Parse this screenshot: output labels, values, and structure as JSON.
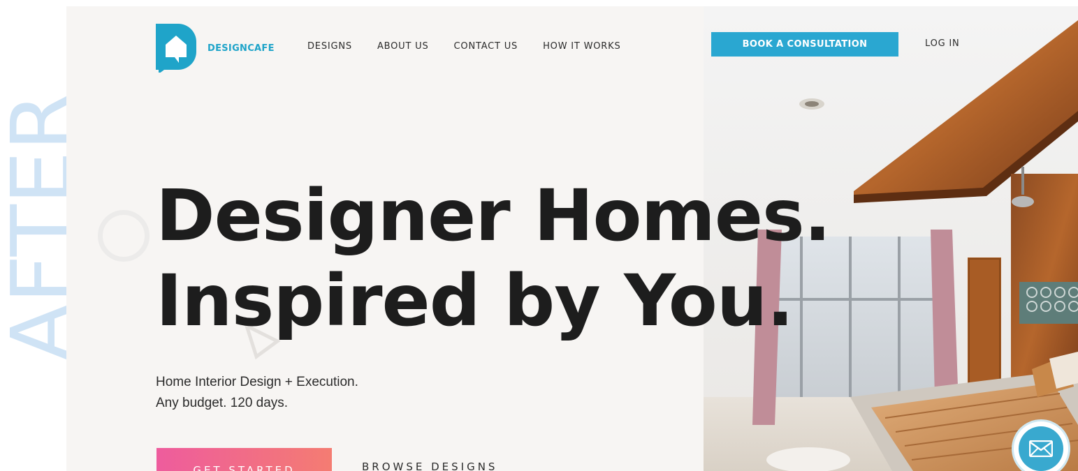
{
  "overlay": {
    "label": "AFTER"
  },
  "brand": {
    "name": "DESIGNCAFE",
    "accent_color": "#1fa4c9"
  },
  "nav": {
    "items": [
      {
        "label": "DESIGNS"
      },
      {
        "label": "ABOUT US"
      },
      {
        "label": "CONTACT US"
      },
      {
        "label": "HOW IT WORKS"
      }
    ],
    "cta_label": "BOOK A CONSULTATION",
    "login_label": "LOG IN"
  },
  "hero": {
    "headline_line1": "Designer Homes.",
    "headline_line2": "Inspired by You.",
    "sub_line1": "Home Interior Design + Execution.",
    "sub_line2": "Any budget. 120 days.",
    "primary_button": "GET STARTED",
    "secondary_button": "BROWSE DESIGNS",
    "image_subject": "bedroom-interior-photo"
  },
  "chat": {
    "icon": "envelope-icon"
  },
  "colors": {
    "cta_blue": "#2aa7d1",
    "gradient_start": "#ee5c9d",
    "gradient_end": "#f47c72",
    "overlay_text": "#cfe3f5"
  }
}
